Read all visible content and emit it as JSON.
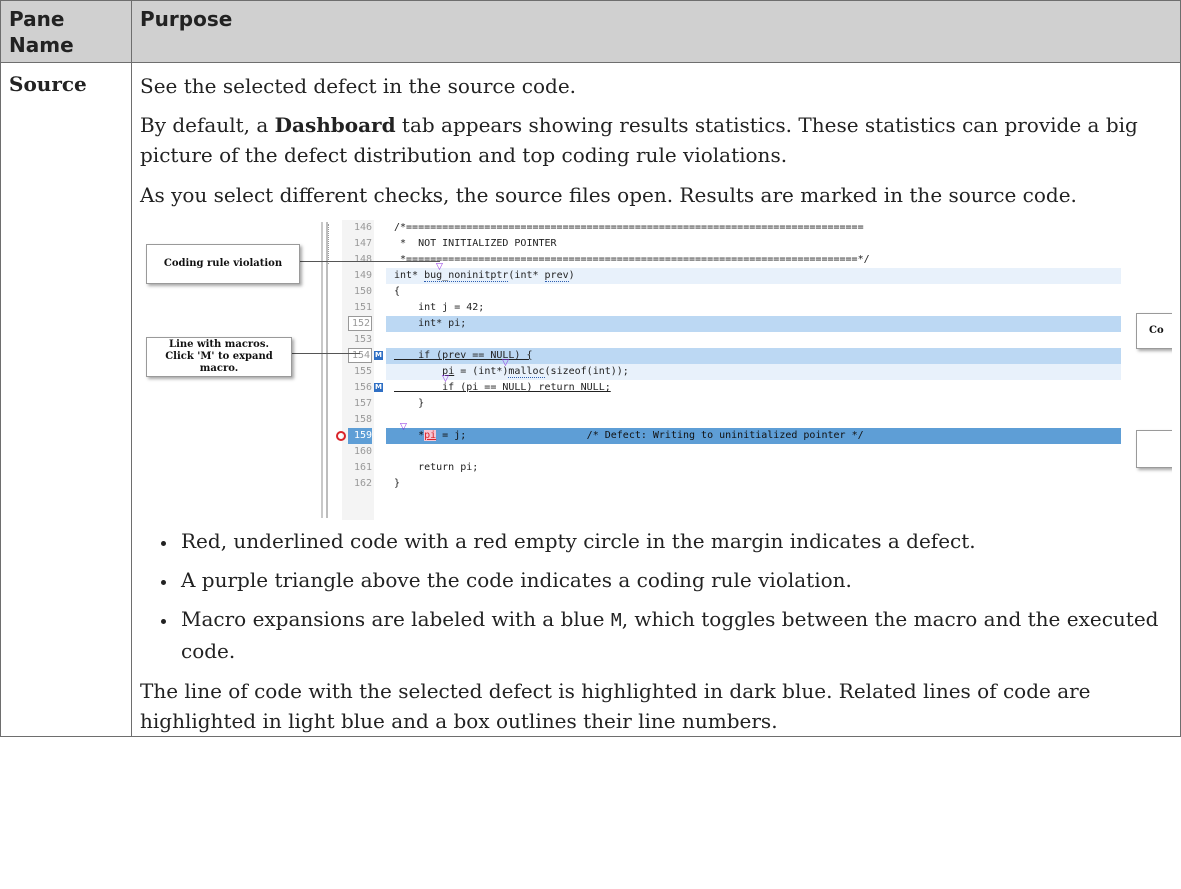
{
  "table": {
    "header": {
      "col1": "Pane Name",
      "col2": "Purpose"
    },
    "row": {
      "name": "Source",
      "p1": "See the selected defect in the source code.",
      "p2_pre": "By default, a ",
      "p2_bold": "Dashboard",
      "p2_post": " tab appears showing results statistics. These statistics can provide a big picture of the defect distribution and top coding rule violations.",
      "p3": "As you select different checks, the source files open. Results are marked in the source code.",
      "bullets": [
        {
          "text": "Red, underlined code with a red empty circle in the margin indicates a defect."
        },
        {
          "text": "A purple triangle above the code indicates a coding rule violation."
        },
        {
          "pre": "Macro expansions are labeled with a blue ",
          "code": "M",
          "post": ", which toggles between the macro and the executed code."
        }
      ],
      "p4": "The line of code with the selected defect is highlighted in dark blue. Related lines of code are highlighted in light blue and a box outlines their line numbers."
    }
  },
  "figure": {
    "callouts": {
      "coding_rule": "Coding rule violation",
      "macros_line1": "Line with macros.",
      "macros_line2": "Click 'M' to expand macro.",
      "right_partial": "Co"
    },
    "lines": [
      {
        "n": "146",
        "code": "/*============================================================================"
      },
      {
        "n": "147",
        "code": " *  NOT INITIALIZED POINTER"
      },
      {
        "n": "148",
        "code": " *===========================================================================*/"
      },
      {
        "n": "149",
        "code_pre": "int* ",
        "code_a": "bug_noninitptr",
        "code_mid": "(int* ",
        "code_b": "prev",
        "code_post": ")"
      },
      {
        "n": "150",
        "code": "{"
      },
      {
        "n": "151",
        "code": "    int j = 42;"
      },
      {
        "n": "152",
        "code": "    int* pi;"
      },
      {
        "n": "153",
        "code": ""
      },
      {
        "n": "154",
        "code": "    if (prev == NULL) {"
      },
      {
        "n": "155",
        "code_pre": "        ",
        "code_a": "pi",
        "code_mid": " = (int*)",
        "code_b": "malloc",
        "code_post": "(sizeof(int));"
      },
      {
        "n": "156",
        "code": "        if (pi == NULL) return NULL;"
      },
      {
        "n": "157",
        "code": "    }"
      },
      {
        "n": "158",
        "code": ""
      },
      {
        "n": "159",
        "code_pre": "    *",
        "code_a": "pi",
        "code_post": " = j;                    /* Defect: Writing to uninitialized pointer */"
      },
      {
        "n": "160",
        "code": ""
      },
      {
        "n": "161",
        "code": "    return pi;"
      },
      {
        "n": "162",
        "code": "}"
      }
    ],
    "macro_label": "M",
    "triangle": "▽"
  }
}
